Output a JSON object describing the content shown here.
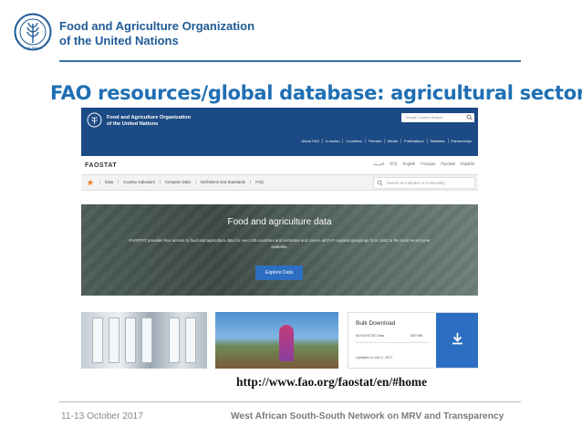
{
  "header": {
    "org_name": "Food and Agriculture Organization\nof the United Nations",
    "brand_color": "#1f5a96"
  },
  "slide_title": "FAO resources/global database: agricultural sectors",
  "screenshot": {
    "org_name": "Food and Agriculture Organization\nof the United Nations",
    "search_placeholder": "Google Custom Search",
    "top_nav": [
      "About FAO",
      "In Action",
      "Countries",
      "Themes",
      "Media",
      "Publications",
      "Statistics",
      "Partnerships"
    ],
    "languages": [
      "العربية",
      "中文",
      "English",
      "Français",
      "Русский",
      "Español"
    ],
    "product": "FAOSTAT",
    "faostat_nav": [
      "Data",
      "Country Indicators",
      "Compare Data",
      "Definitions and Standards",
      "FAQ"
    ],
    "faostat_search_placeholder": "Search an Indicator or Commodity",
    "hero": {
      "title": "Food and agriculture data",
      "text": "FAOSTAT provides free access to food and agriculture data for over 245 countries and territories and covers all FAO regional groupings from 1961 to the most recent year available.",
      "button": "Explore Data"
    },
    "bulk": {
      "title": "Bulk Download",
      "label": "All FAOSTAT Data",
      "size": "820 MB",
      "updated": "Updated on Oct 2, 2017"
    },
    "accent": "#2c6fc2",
    "topbar_color": "#1c4a84"
  },
  "url_caption": "http://www.fao.org/faostat/en/#home",
  "footer": {
    "date": "11-13 October 2017",
    "network": "West African South-South Network on MRV and Transparency"
  }
}
